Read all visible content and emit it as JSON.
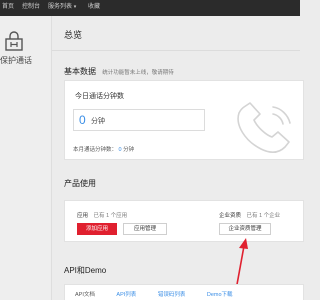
{
  "topnav": {
    "items": [
      "首页",
      "控制台",
      "服务列表",
      "收藏"
    ],
    "services_caret": "▾"
  },
  "sidebar": {
    "product_label": "保护通话"
  },
  "page": {
    "title": "总览"
  },
  "basic_data": {
    "title": "基本数据",
    "subtitle": "统计功能暂未上线，敬请期待",
    "today_title": "今日通话分钟数",
    "today_value": "0",
    "today_unit": "分钟",
    "month_label": "本月通话分钟数：",
    "month_value": "0",
    "month_unit": "分钟"
  },
  "product_usage": {
    "title": "产品使用",
    "apps": {
      "label": "应用",
      "count": "已有 1 个应用",
      "add_button": "添加应用",
      "manage_button": "应用管理"
    },
    "enterprise": {
      "label": "企业资质",
      "count": "已有 1 个企业",
      "manage_button": "企业资质管理"
    }
  },
  "api": {
    "title": "API和Demo",
    "row_label": "API文档",
    "links": [
      "API列表",
      "错误码列表",
      "Demo下载"
    ]
  },
  "colors": {
    "accent_blue": "#3a8ee6",
    "primary_red": "#e0202f",
    "topbar": "#2b2b2b"
  }
}
